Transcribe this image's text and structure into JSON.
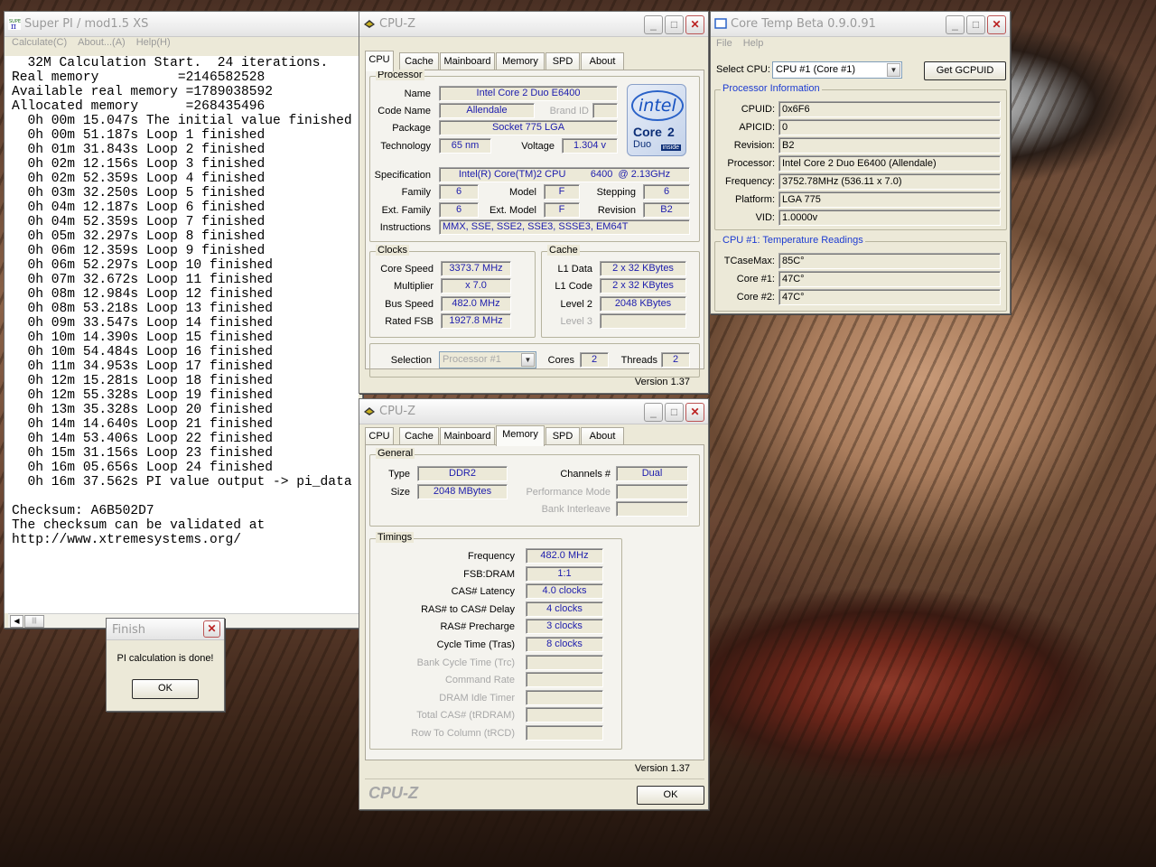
{
  "superpi": {
    "title": "Super PI / mod1.5 XS",
    "menu": [
      "Calculate(C)",
      "About...(A)",
      "Help(H)"
    ],
    "lines": [
      "  32M Calculation Start.  24 iterations.",
      "Real memory          =2146582528",
      "Available real memory =1789038592",
      "Allocated memory      =268435496",
      "  0h 00m 15.047s The initial value finished",
      "  0h 00m 51.187s Loop 1 finished",
      "  0h 01m 31.843s Loop 2 finished",
      "  0h 02m 12.156s Loop 3 finished",
      "  0h 02m 52.359s Loop 4 finished",
      "  0h 03m 32.250s Loop 5 finished",
      "  0h 04m 12.187s Loop 6 finished",
      "  0h 04m 52.359s Loop 7 finished",
      "  0h 05m 32.297s Loop 8 finished",
      "  0h 06m 12.359s Loop 9 finished",
      "  0h 06m 52.297s Loop 10 finished",
      "  0h 07m 32.672s Loop 11 finished",
      "  0h 08m 12.984s Loop 12 finished",
      "  0h 08m 53.218s Loop 13 finished",
      "  0h 09m 33.547s Loop 14 finished",
      "  0h 10m 14.390s Loop 15 finished",
      "  0h 10m 54.484s Loop 16 finished",
      "  0h 11m 34.953s Loop 17 finished",
      "  0h 12m 15.281s Loop 18 finished",
      "  0h 12m 55.328s Loop 19 finished",
      "  0h 13m 35.328s Loop 20 finished",
      "  0h 14m 14.640s Loop 21 finished",
      "  0h 14m 53.406s Loop 22 finished",
      "  0h 15m 31.156s Loop 23 finished",
      "  0h 16m 05.656s Loop 24 finished",
      "  0h 16m 37.562s PI value output -> pi_data",
      "",
      "Checksum: A6B502D7",
      "The checksum can be validated at",
      "http://www.xtremesystems.org/"
    ]
  },
  "finish": {
    "title": "Finish",
    "message": "PI calculation is done!",
    "ok": "OK"
  },
  "cpuz_cpu": {
    "title": "CPU-Z",
    "tabs": [
      "CPU",
      "Cache",
      "Mainboard",
      "Memory",
      "SPD",
      "About"
    ],
    "processor_group": "Processor",
    "labels": {
      "name": "Name",
      "codename": "Code Name",
      "brandid": "Brand ID",
      "package": "Package",
      "technology": "Technology",
      "voltage": "Voltage",
      "specification": "Specification",
      "family": "Family",
      "model": "Model",
      "stepping": "Stepping",
      "extfamily": "Ext. Family",
      "extmodel": "Ext. Model",
      "revision": "Revision",
      "instructions": "Instructions"
    },
    "values": {
      "name": "Intel Core 2 Duo E6400",
      "codename": "Allendale",
      "package": "Socket 775 LGA",
      "technology": "65 nm",
      "voltage": "1.304 v",
      "specification": "Intel(R) Core(TM)2 CPU         6400  @ 2.13GHz",
      "family": "6",
      "model": "F",
      "stepping": "6",
      "extfamily": "6",
      "extmodel": "F",
      "revision": "B2",
      "instructions": "MMX, SSE, SSE2, SSE3, SSSE3, EM64T"
    },
    "logo": {
      "brand": "intel",
      "line1": "Core",
      "line2": "2",
      "line3": "Duo",
      "inside": "inside"
    },
    "clocks_group": "Clocks",
    "clocks": {
      "corespeed_l": "Core Speed",
      "corespeed": "3373.7 MHz",
      "multiplier_l": "Multiplier",
      "multiplier": "x 7.0",
      "busspeed_l": "Bus Speed",
      "busspeed": "482.0 MHz",
      "ratedfsb_l": "Rated FSB",
      "ratedfsb": "1927.8 MHz"
    },
    "cache_group": "Cache",
    "cache": {
      "l1data_l": "L1 Data",
      "l1data": "2 x 32 KBytes",
      "l1code_l": "L1 Code",
      "l1code": "2 x 32 KBytes",
      "level2_l": "Level 2",
      "level2": "2048 KBytes",
      "level3_l": "Level 3"
    },
    "selection_l": "Selection",
    "selection": "Processor #1",
    "cores_l": "Cores",
    "cores": "2",
    "threads_l": "Threads",
    "threads": "2",
    "version": "Version 1.37"
  },
  "cpuz_mem": {
    "title": "CPU-Z",
    "tabs": [
      "CPU",
      "Cache",
      "Mainboard",
      "Memory",
      "SPD",
      "About"
    ],
    "general_group": "General",
    "general": {
      "type_l": "Type",
      "type": "DDR2",
      "size_l": "Size",
      "size": "2048 MBytes",
      "channels_l": "Channels #",
      "channels": "Dual",
      "perfmode_l": "Performance Mode",
      "bankinter_l": "Bank Interleave"
    },
    "timings_group": "Timings",
    "timings": [
      {
        "label": "Frequency",
        "value": "482.0 MHz"
      },
      {
        "label": "FSB:DRAM",
        "value": "1:1"
      },
      {
        "label": "CAS# Latency",
        "value": "4.0 clocks"
      },
      {
        "label": "RAS# to CAS# Delay",
        "value": "4 clocks"
      },
      {
        "label": "RAS# Precharge",
        "value": "3 clocks"
      },
      {
        "label": "Cycle Time (Tras)",
        "value": "8 clocks"
      },
      {
        "label": "Bank Cycle Time (Trc)",
        "value": ""
      },
      {
        "label": "Command Rate",
        "value": ""
      },
      {
        "label": "DRAM Idle Timer",
        "value": ""
      },
      {
        "label": "Total CAS# (tRDRAM)",
        "value": ""
      },
      {
        "label": "Row To Column (tRCD)",
        "value": ""
      }
    ],
    "version": "Version 1.37",
    "brand": "CPU-Z",
    "ok": "OK"
  },
  "coretemp": {
    "title": "Core Temp Beta 0.9.0.91",
    "menu": [
      "File",
      "Help"
    ],
    "selectcpu_l": "Select CPU:",
    "selectcpu": "CPU #1 (Core #1)",
    "gcpuid": "Get GCPUID",
    "procinfo": "Processor Information",
    "info": [
      {
        "label": "CPUID:",
        "value": "0x6F6"
      },
      {
        "label": "APICID:",
        "value": "0"
      },
      {
        "label": "Revision:",
        "value": "B2"
      },
      {
        "label": "Processor:",
        "value": "Intel Core 2 Duo E6400 (Allendale)"
      },
      {
        "label": "Frequency:",
        "value": "3752.78MHz (536.11 x 7.0)"
      },
      {
        "label": "Platform:",
        "value": "LGA 775"
      },
      {
        "label": "VID:",
        "value": "1.0000v"
      }
    ],
    "temps_title": "CPU #1: Temperature Readings",
    "temps": [
      {
        "label": "TCaseMax:",
        "value": "85C°"
      },
      {
        "label": "Core #1:",
        "value": "47C°"
      },
      {
        "label": "Core #2:",
        "value": "47C°"
      }
    ]
  }
}
